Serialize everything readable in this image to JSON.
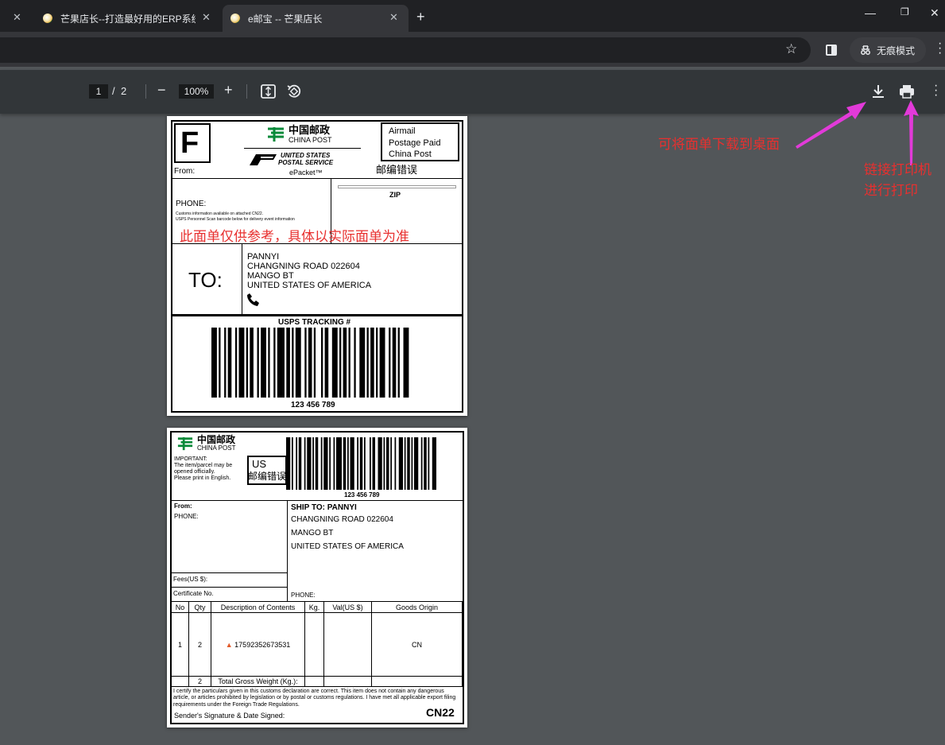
{
  "browser": {
    "tabs": [
      {
        "label": "芒果店长--打造最好用的ERP系统"
      },
      {
        "label": "e邮宝 -- 芒果店长"
      }
    ],
    "incognito_label": "无痕模式"
  },
  "pdf_toolbar": {
    "page_current": "1",
    "page_sep": "/",
    "page_total": "2",
    "zoom": "100%"
  },
  "label1": {
    "service_letter": "F",
    "china_post_cn": "中国邮政",
    "china_post_en": "CHINA POST",
    "usps_line1": "UNITED STATES",
    "usps_line2": "POSTAL SERVICE",
    "epacket": "ePacket™",
    "from_label": "From:",
    "postage_box": [
      "Airmail",
      "Postage Paid",
      "China Post"
    ],
    "zip_error": "邮编错误",
    "phone_label": "PHONE:",
    "customs_note_1": "Customs information avaliable on attached CN22.",
    "customs_note_2": "USPS Personnel Scan barcode below for delivery event information",
    "zip_label": "ZIP",
    "reference_note": "此面单仅供参考，具体以实际面单为准",
    "to_label": "TO:",
    "recipient": [
      "PANNYI",
      "CHANGNING ROAD 022604",
      "MANGO BT",
      "UNITED STATES OF AMERICA"
    ],
    "tracking_label": "USPS TRACKING #",
    "tracking_number": "123 456 789"
  },
  "label2": {
    "china_post_cn": "中国邮政",
    "china_post_en": "CHINA POST",
    "important": [
      "IMPORTANT:",
      "The item/parcel may be",
      "opened officially.",
      "Please print in English."
    ],
    "country_code": "US",
    "zip_error": "邮编错误",
    "barcode_number": "123 456 789",
    "from_label": "From:",
    "phone_label": "PHONE:",
    "ship_to_title": "SHIP TO: PANNYI",
    "ship_to_lines": [
      "CHANGNING ROAD 022604",
      "MANGO BT",
      "UNITED STATES OF AMERICA"
    ],
    "fees_label": "Fees(US $):",
    "certificate_label": "Certificate No.",
    "recipient_phone_label": "PHONE:",
    "table_headers": [
      "No",
      "Qty",
      "Description of Contents",
      "Kg.",
      "Val(US $)",
      "Goods Origin"
    ],
    "row": {
      "no": "1",
      "qty": "2",
      "description": "17592352673531",
      "kg": "",
      "val": "",
      "origin": "CN"
    },
    "total_qty": "2",
    "total_weight_label": "Total Gross Weight (Kg.):",
    "certify_text": "I certify the particulars given in this customs declaration are correct. This item does not contain any dangerous article, or articles prohibited by legislation or by postal or customs regulations. I have met all applicable export filing requirements under the Foreign Trade Regulations.",
    "signature_label": "Sender's Signature & Date Signed:",
    "form_code": "CN22"
  },
  "annotations": {
    "download_note": "可将面单下载到桌面",
    "print_note_1": "链接打印机",
    "print_note_2": "进行打印",
    "red": "#e8302f",
    "magenta": "#e23ad9"
  }
}
